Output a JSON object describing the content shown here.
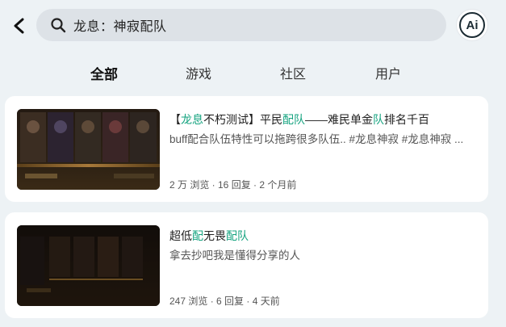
{
  "header": {
    "search_query": "龙息：神寂配队",
    "ai_label": "Ai"
  },
  "tabs": [
    {
      "label": "全部",
      "active": true
    },
    {
      "label": "游戏",
      "active": false
    },
    {
      "label": "社区",
      "active": false
    },
    {
      "label": "用户",
      "active": false
    }
  ],
  "results": [
    {
      "title_parts": [
        "【",
        "龙息",
        "不朽测试】平民",
        "配队",
        "——难民单金",
        "队",
        "排名千百"
      ],
      "description": "buff配合队伍特性可以拖跨很多队伍.. #龙息神寂 #龙息神寂 ...",
      "meta": "2 万 浏览 · 16 回复 · 2 个月前"
    },
    {
      "title_parts": [
        "超低",
        "配",
        "无畏",
        "配队"
      ],
      "description": "拿去抄吧我是懂得分享的人",
      "meta": "247 浏览 · 6 回复 · 4 天前"
    }
  ],
  "colors": {
    "accent": "#1ec99b",
    "highlight": "#14a37f",
    "background": "#edf2f5"
  }
}
